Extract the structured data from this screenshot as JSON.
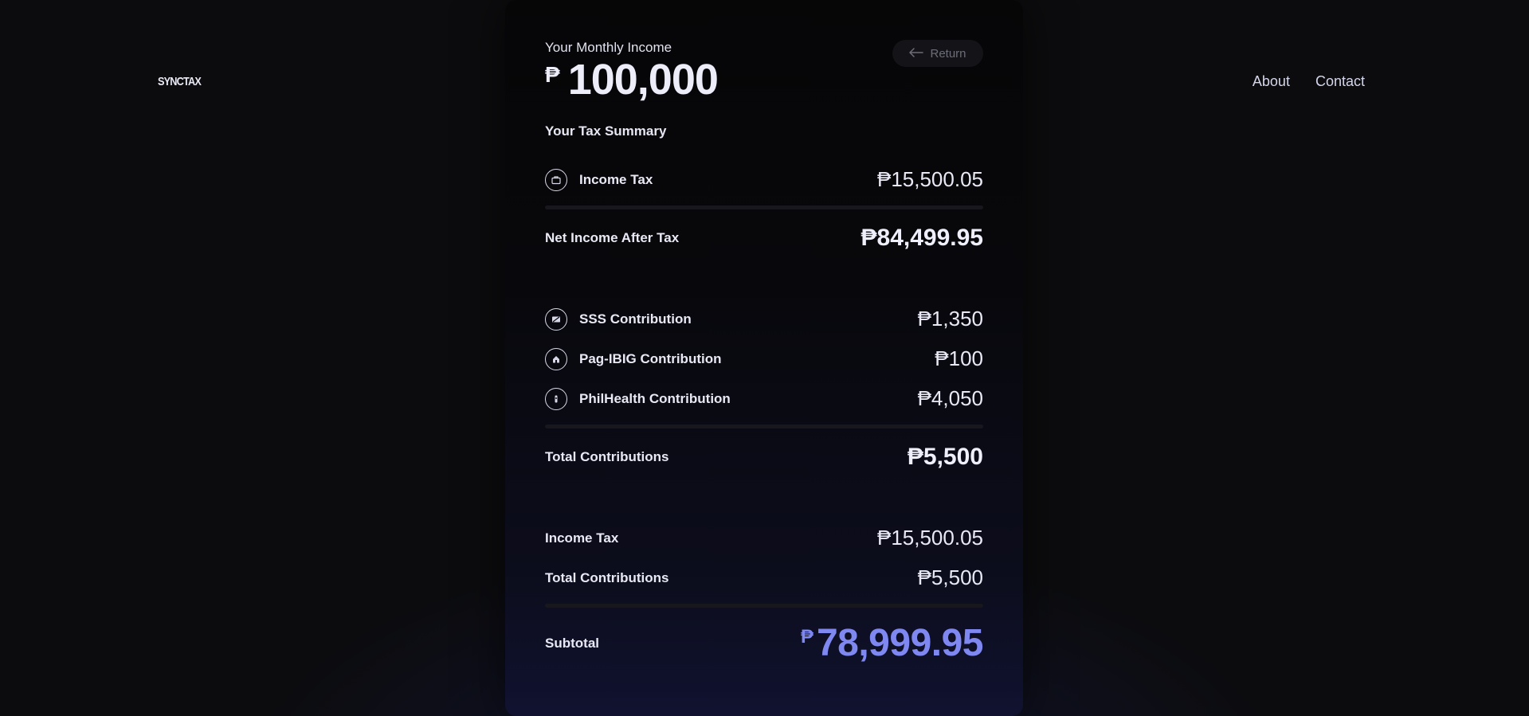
{
  "nav": {
    "logo": "SYNCTAX",
    "links": [
      {
        "label": "About"
      },
      {
        "label": "Contact"
      }
    ]
  },
  "header": {
    "income_label": "Your Monthly Income",
    "currency_symbol": "₱",
    "income_value": "100,000",
    "return_label": "Return"
  },
  "summary": {
    "title": "Your Tax Summary",
    "income_tax": {
      "label": "Income Tax",
      "value": "₱15,500.05",
      "icon": "briefcase-icon"
    },
    "net_income": {
      "label": "Net Income After Tax",
      "value": "₱84,499.95"
    }
  },
  "contributions": {
    "items": [
      {
        "label": "SSS Contribution",
        "value": "₱1,350",
        "icon": "card-icon"
      },
      {
        "label": "Pag-IBIG Contribution",
        "value": "₱100",
        "icon": "home-icon"
      },
      {
        "label": "PhilHealth Contribution",
        "value": "₱4,050",
        "icon": "health-icon"
      }
    ],
    "total": {
      "label": "Total Contributions",
      "value": "₱5,500"
    }
  },
  "totals": {
    "income_tax": {
      "label": "Income Tax",
      "value": "₱15,500.05"
    },
    "contributions": {
      "label": "Total Contributions",
      "value": "₱5,500"
    },
    "subtotal": {
      "label": "Subtotal",
      "currency": "₱",
      "value": "78,999.95"
    }
  },
  "colors": {
    "accent": "#7e88f0",
    "background": "#0c0c0e",
    "card": "#08080c"
  }
}
